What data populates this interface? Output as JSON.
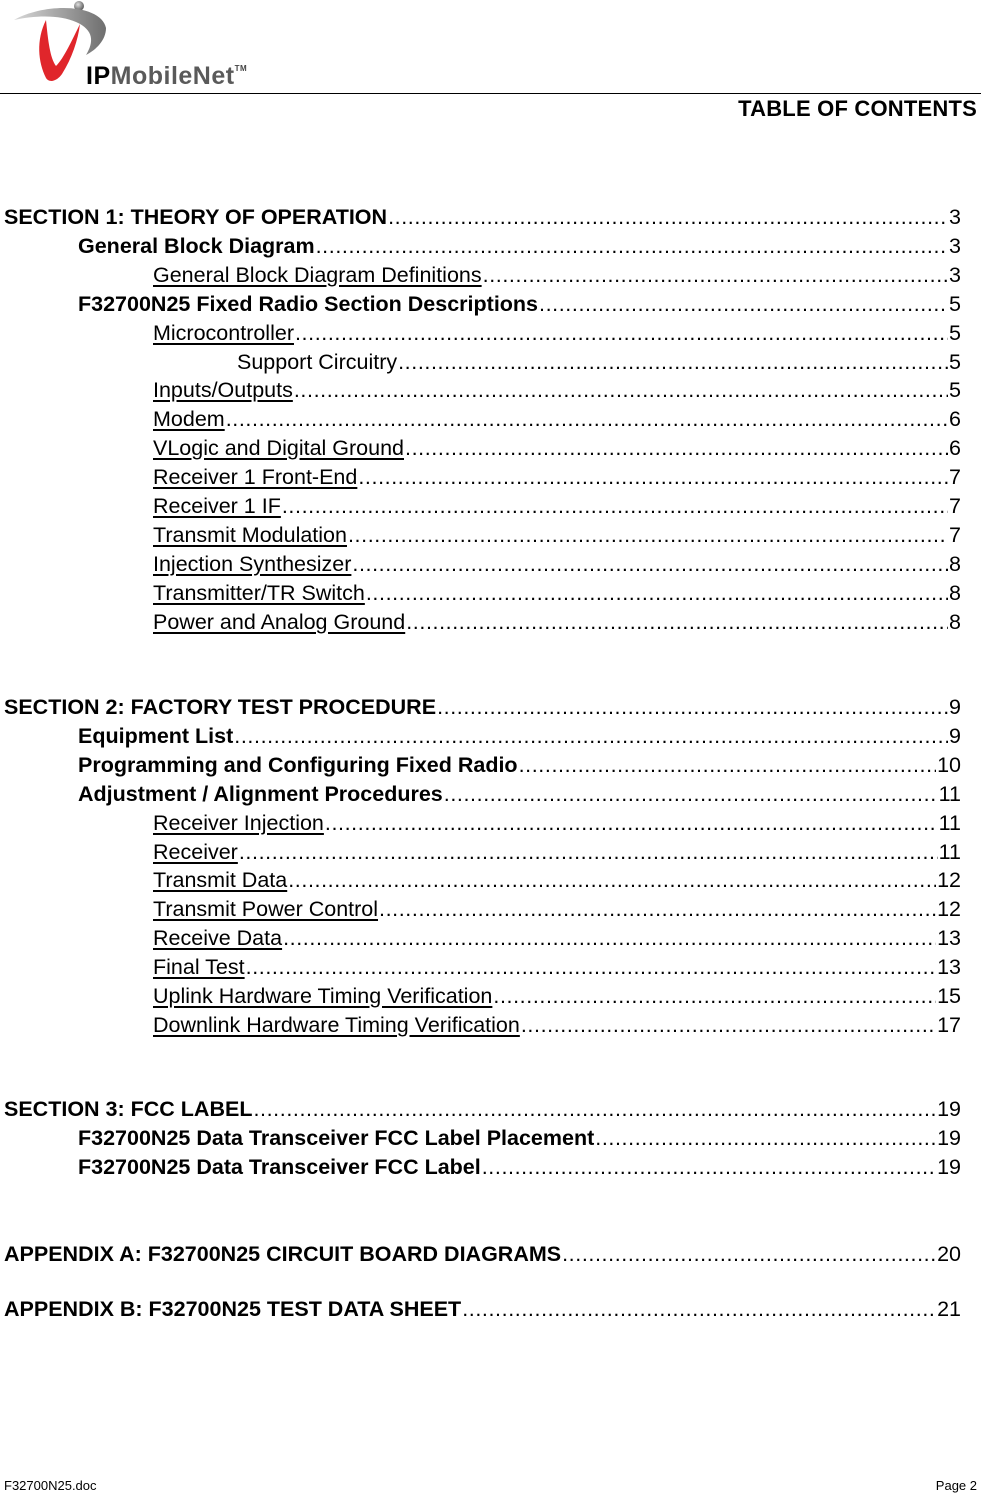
{
  "header": {
    "logo_text_ip": "IP",
    "logo_text_rest": "MobileNet",
    "logo_tm": "TM",
    "title": "TABLE OF CONTENTS"
  },
  "toc": [
    {
      "level": 1,
      "label": "SECTION 1:  THEORY OF OPERATION",
      "page": "3"
    },
    {
      "level": 2,
      "label": "General Block Diagram",
      "page": "3"
    },
    {
      "level": 3,
      "label": "General Block Diagram Definitions",
      "page": "3"
    },
    {
      "level": 2,
      "label": "F32700N25 Fixed Radio Section Descriptions",
      "page": "5"
    },
    {
      "level": 3,
      "label": "Microcontroller",
      "page": "5"
    },
    {
      "level": 4,
      "label": "Support Circuitry",
      "page": "5"
    },
    {
      "level": 3,
      "label": "Inputs/Outputs",
      "page": "5"
    },
    {
      "level": 3,
      "label": "Modem",
      "page": "6"
    },
    {
      "level": 3,
      "label": "VLogic and Digital Ground",
      "page": "6"
    },
    {
      "level": 3,
      "label": "Receiver 1 Front-End",
      "page": "7"
    },
    {
      "level": 3,
      "label": "Receiver 1 IF",
      "page": "7"
    },
    {
      "level": 3,
      "label": "Transmit Modulation",
      "page": "7"
    },
    {
      "level": 3,
      "label": "Injection Synthesizer",
      "page": "8"
    },
    {
      "level": 3,
      "label": "Transmitter/TR Switch",
      "page": "8"
    },
    {
      "level": 3,
      "label": "Power and Analog Ground",
      "page": "8"
    },
    {
      "level": 1,
      "label": "SECTION 2:  FACTORY TEST PROCEDURE",
      "page": "9"
    },
    {
      "level": 2,
      "label": "Equipment List",
      "page": "9"
    },
    {
      "level": 2,
      "label": "Programming and Configuring Fixed Radio",
      "page": "10"
    },
    {
      "level": 2,
      "label": "Adjustment / Alignment Procedures",
      "page": "11"
    },
    {
      "level": 3,
      "label": "Receiver Injection",
      "page": "11"
    },
    {
      "level": 3,
      "label": "Receiver",
      "page": "11"
    },
    {
      "level": 3,
      "label": "Transmit Data",
      "page": "12"
    },
    {
      "level": 3,
      "label": "Transmit Power Control",
      "page": "12"
    },
    {
      "level": 3,
      "label": "Receive Data",
      "page": "13"
    },
    {
      "level": 3,
      "label": "Final Test",
      "page": "13"
    },
    {
      "level": 3,
      "label": "Uplink Hardware Timing Verification",
      "page": "15"
    },
    {
      "level": 3,
      "label": "Downlink Hardware Timing Verification",
      "page": "17"
    },
    {
      "level": 1,
      "label": "SECTION 3:  FCC LABEL",
      "page": "19"
    },
    {
      "level": 2,
      "label": "F32700N25 Data Transceiver FCC Label Placement",
      "page": "19"
    },
    {
      "level": 2,
      "label": "F32700N25 Data Transceiver FCC Label",
      "page": "19"
    },
    {
      "level": 1,
      "label": "APPENDIX A:  F32700N25 CIRCUIT BOARD DIAGRAMS",
      "page": "20"
    },
    {
      "level": 1,
      "label": "APPENDIX B:  F32700N25 TEST DATA SHEET",
      "page": "21"
    }
  ],
  "footer": {
    "filename": "F32700N25.doc",
    "page": "Page 2"
  }
}
